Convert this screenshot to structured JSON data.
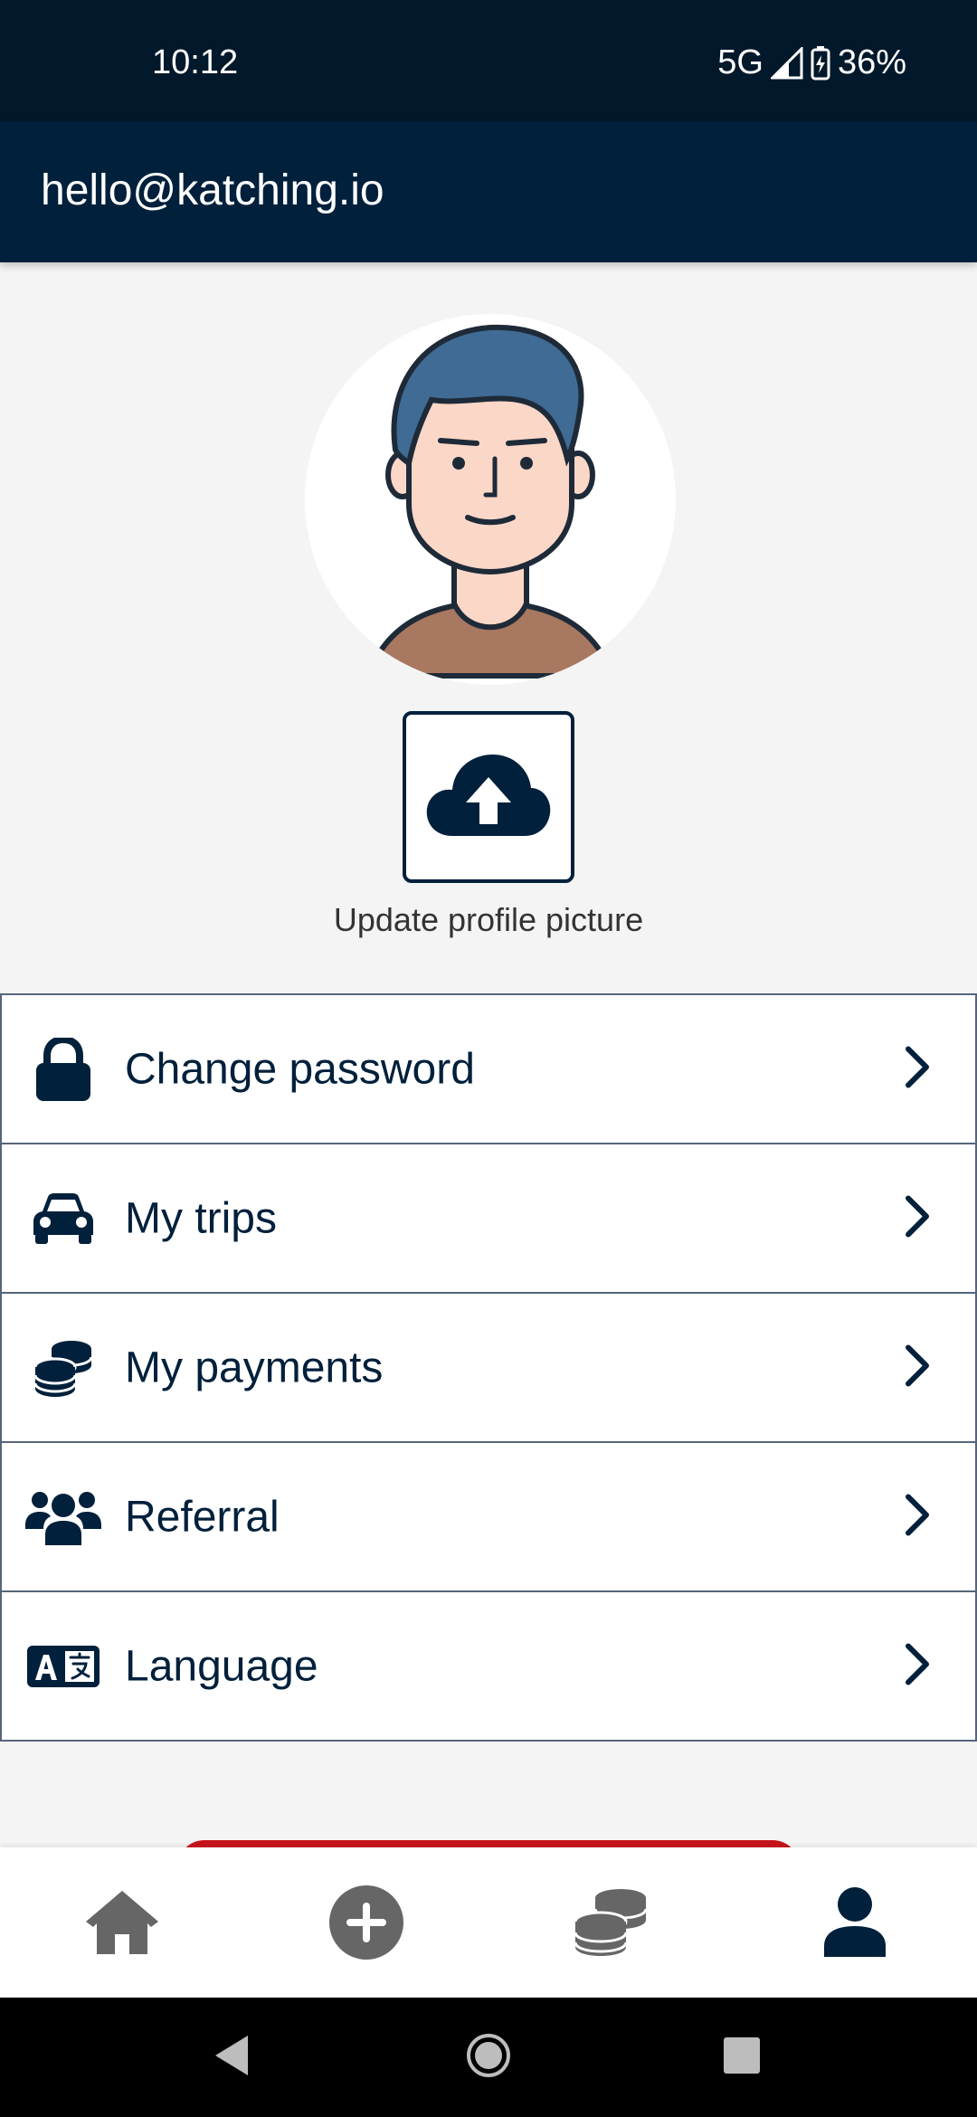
{
  "status": {
    "time": "10:12",
    "network": "5G",
    "battery": "36%"
  },
  "header": {
    "email": "hello@katching.io"
  },
  "profile": {
    "update_label": "Update profile picture"
  },
  "menu": [
    {
      "label": "Change password",
      "icon": "lock-icon"
    },
    {
      "label": "My trips",
      "icon": "car-icon"
    },
    {
      "label": "My payments",
      "icon": "coins-icon"
    },
    {
      "label": "Referral",
      "icon": "users-icon"
    },
    {
      "label": "Language",
      "icon": "language-icon"
    }
  ],
  "bottom_nav": [
    {
      "name": "home",
      "icon": "home-icon",
      "active": false
    },
    {
      "name": "add",
      "icon": "plus-circle-icon",
      "active": false
    },
    {
      "name": "payments",
      "icon": "coins-icon",
      "active": false
    },
    {
      "name": "profile",
      "icon": "user-icon",
      "active": true
    }
  ],
  "colors": {
    "primary": "#00203b",
    "status_bar": "#02182b",
    "accent_red": "#c8141c",
    "inactive_icon": "#666666"
  }
}
